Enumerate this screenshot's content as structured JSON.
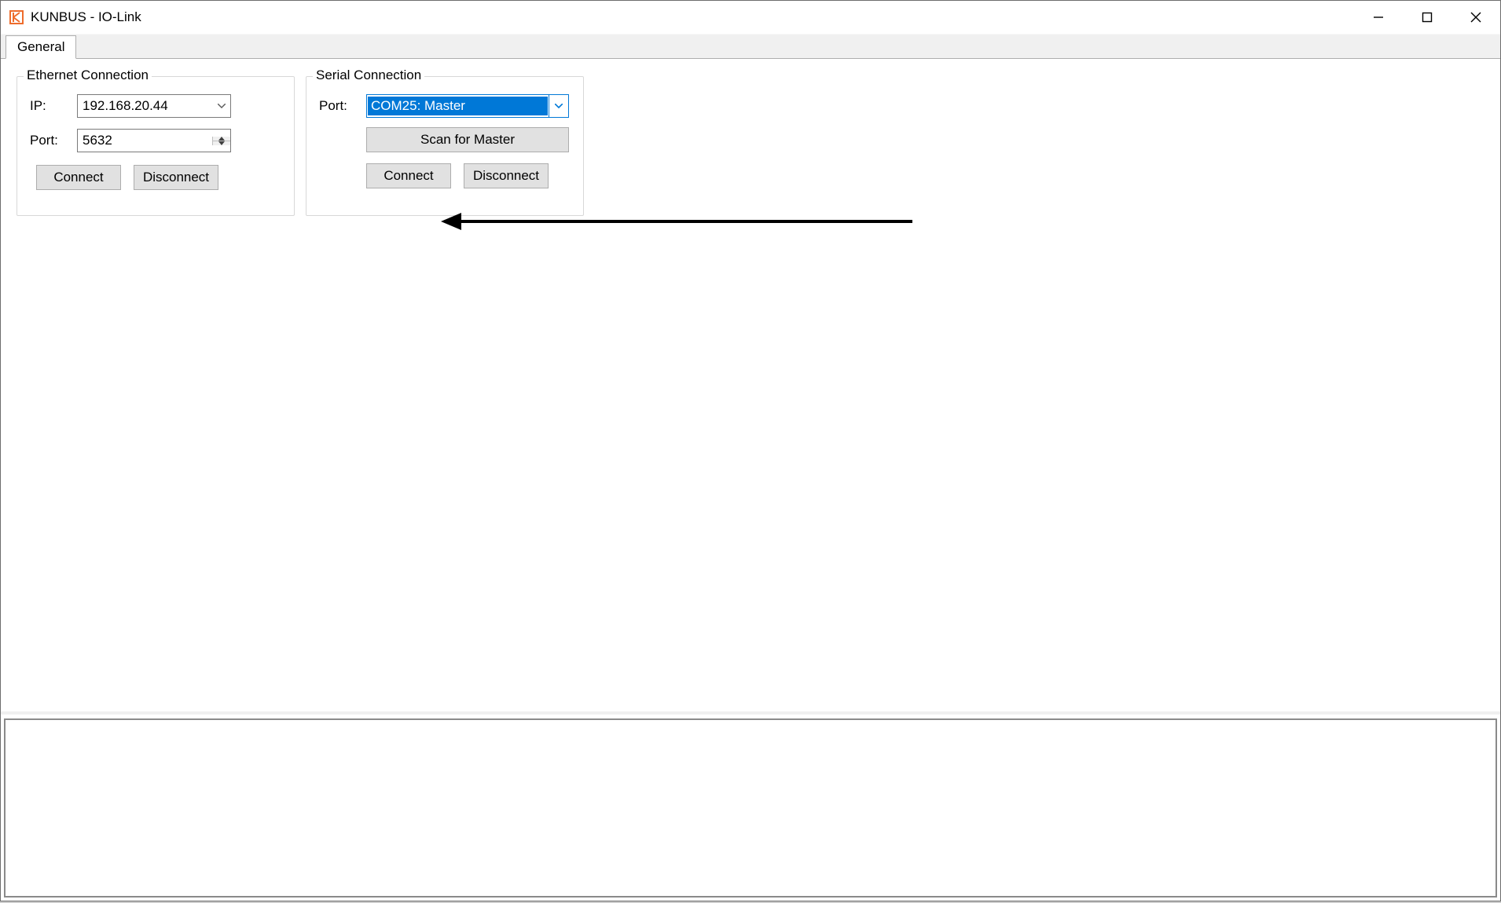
{
  "window": {
    "title": "KUNBUS - IO-Link"
  },
  "tabs": {
    "general": "General"
  },
  "ethernet": {
    "legend": "Ethernet Connection",
    "ip_label": "IP:",
    "ip_value": "192.168.20.44",
    "port_label": "Port:",
    "port_value": "5632",
    "connect": "Connect",
    "disconnect": "Disconnect"
  },
  "serial": {
    "legend": "Serial Connection",
    "port_label": "Port:",
    "port_value": "COM25: Master",
    "scan": "Scan for Master",
    "connect": "Connect",
    "disconnect": "Disconnect"
  }
}
